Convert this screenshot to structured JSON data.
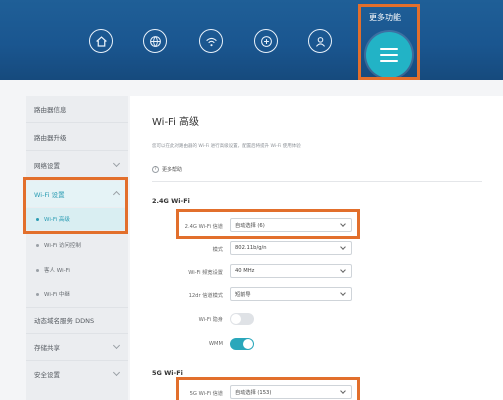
{
  "header": {
    "more_label": "更多功能",
    "nav_icons": [
      "home-icon",
      "globe-icon",
      "wifi-icon",
      "device-icon",
      "user-icon"
    ],
    "menu_icon": "hamburger-menu-icon",
    "colors": {
      "header": "#1a5690",
      "accent": "#22b3c6",
      "highlight": "#e26f2c"
    }
  },
  "sidebar": {
    "items": [
      {
        "label": "路由器信息"
      },
      {
        "label": "路由器升级"
      },
      {
        "label": "网络设置"
      },
      {
        "label": "Wi-Fi 设置"
      },
      {
        "label": "Wi-Fi 高级"
      },
      {
        "label": "Wi-Fi 访问控制"
      },
      {
        "label": "客人 Wi-Fi"
      },
      {
        "label": "Wi-Fi 中继"
      },
      {
        "label": "动态域名服务 DDNS"
      },
      {
        "label": "存储共享"
      },
      {
        "label": "安全设置"
      }
    ]
  },
  "main": {
    "title": "Wi-Fi 高级",
    "description": "您可以在此对路由器的 Wi-Fi 进行高级设置，配置后将提升 Wi-Fi 使用体验",
    "help": "更多帮助",
    "section_24": "2.4G Wi-Fi",
    "rows_24": [
      {
        "label": "2.4G Wi-Fi 信道",
        "value": "自动选择 (6)"
      },
      {
        "label": "模式",
        "value": "802.11b/g/n"
      },
      {
        "label": "Wi-Fi 频宽设置",
        "value": "40 MHz"
      },
      {
        "label": "12dr 信道模式",
        "value": "短前导"
      }
    ],
    "toggle_rows": [
      {
        "label": "Wi-Fi 隐身",
        "on": false
      },
      {
        "label": "WMM",
        "on": true
      }
    ],
    "section_5": "5G Wi-Fi",
    "rows_5": [
      {
        "label": "5G Wi-Fi 信道",
        "value": "自动选择 (153)"
      }
    ]
  }
}
